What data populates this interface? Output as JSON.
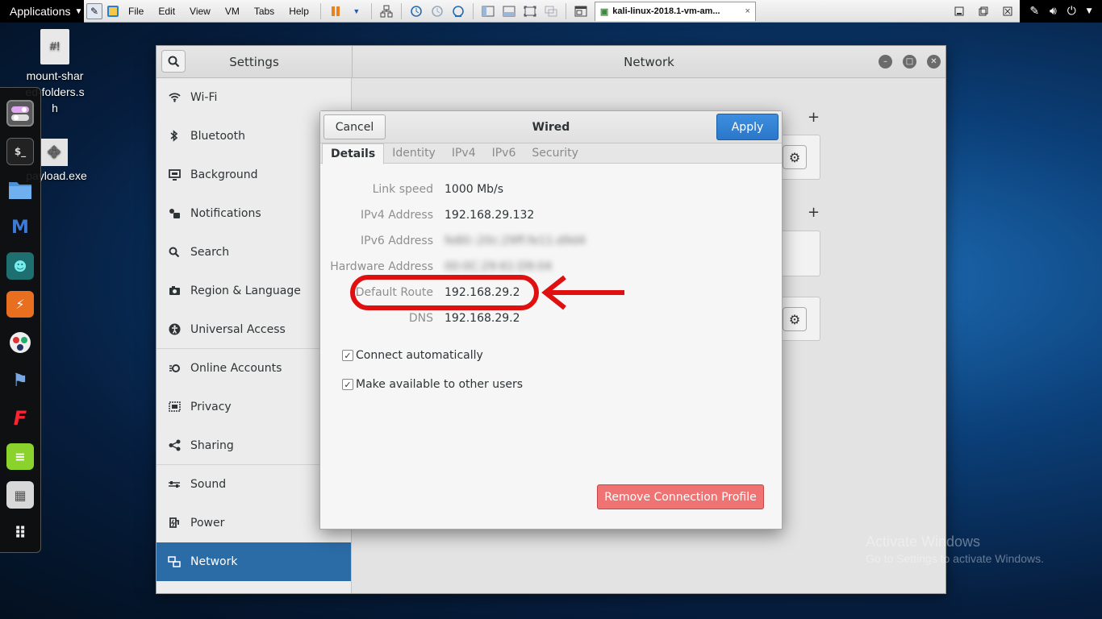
{
  "kali_topbar": {
    "applications_label": "Applications"
  },
  "vmware": {
    "menus": [
      "File",
      "Edit",
      "View",
      "VM",
      "Tabs",
      "Help"
    ],
    "tab_label": "kali-linux-2018.1-vm-am...",
    "tab_close": "×"
  },
  "desktop": {
    "file_icon_label": "mount-shared-folders.sh",
    "file_icon_glyph": "#!",
    "payload_label": "payload.exe"
  },
  "settings": {
    "title": "Settings",
    "panel_title": "Network",
    "sidebar": [
      {
        "label": "Wi-Fi",
        "icon": "wifi-icon",
        "glyph": "▿"
      },
      {
        "label": "Bluetooth",
        "icon": "bluetooth-icon",
        "glyph": "ʙ"
      },
      {
        "label": "Background",
        "icon": "monitor-icon",
        "glyph": "▣"
      },
      {
        "label": "Notifications",
        "icon": "notifications-icon",
        "glyph": "▪"
      },
      {
        "label": "Search",
        "icon": "search-icon",
        "glyph": "⚲"
      },
      {
        "label": "Region & Language",
        "icon": "camera-icon",
        "glyph": "▤"
      },
      {
        "label": "Universal Access",
        "icon": "accessibility-icon",
        "glyph": "✪"
      },
      {
        "label": "Online Accounts",
        "icon": "accounts-icon",
        "glyph": "⊶"
      },
      {
        "label": "Privacy",
        "icon": "privacy-icon",
        "glyph": "▦"
      },
      {
        "label": "Sharing",
        "icon": "share-icon",
        "glyph": "∴"
      },
      {
        "label": "Sound",
        "icon": "sound-icon",
        "glyph": "≡"
      },
      {
        "label": "Power",
        "icon": "power-icon",
        "glyph": "↯"
      },
      {
        "label": "Network",
        "icon": "network-icon",
        "glyph": "▧"
      }
    ],
    "active_item": "Network",
    "plus_label": "+"
  },
  "wired_dialog": {
    "title": "Wired",
    "cancel_label": "Cancel",
    "apply_label": "Apply",
    "tabs": [
      "Details",
      "Identity",
      "IPv4",
      "IPv6",
      "Security"
    ],
    "active_tab": "Details",
    "details": [
      {
        "label": "Link speed",
        "value": "1000 Mb/s",
        "blurred": false
      },
      {
        "label": "IPv4 Address",
        "value": "192.168.29.132",
        "blurred": false
      },
      {
        "label": "IPv6 Address",
        "value": "fe80::20c:29ff:fe11:d9d4",
        "blurred": true
      },
      {
        "label": "Hardware Address",
        "value": "00:0C:29:61:D9:04",
        "blurred": true
      },
      {
        "label": "Default Route",
        "value": "192.168.29.2",
        "blurred": false
      },
      {
        "label": "DNS",
        "value": "192.168.29.2",
        "blurred": false
      }
    ],
    "checkboxes": [
      {
        "label": "Connect automatically",
        "checked": true
      },
      {
        "label": "Make available to other users",
        "checked": true
      }
    ],
    "remove_label": "Remove Connection Profile"
  },
  "watermark": {
    "line1": "Activate Windows",
    "line2": "Go to Settings to activate Windows."
  },
  "colors": {
    "accent_blue": "#2b6ca7",
    "apply_blue": "#2b77c9",
    "remove_red": "#ef7373",
    "annotation_red": "#e01010"
  }
}
